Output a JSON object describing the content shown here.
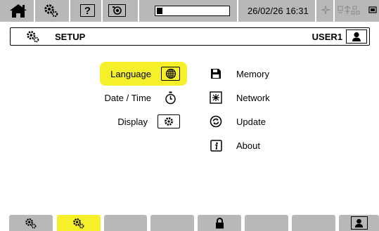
{
  "status_bar": {
    "datetime": "26/02/26 16:31",
    "battery_level": 0.08,
    "icons": [
      "home-icon",
      "gear-icon",
      "help-icon",
      "camera-icon",
      "battery-icon",
      "gps-icon",
      "usb-network-icon",
      "storage-icon"
    ],
    "help_glyph": "?"
  },
  "header": {
    "title": "SETUP",
    "user": "USER1"
  },
  "menu": {
    "left": [
      {
        "label": "Language",
        "icon": "globe-icon",
        "selected": true
      },
      {
        "label": "Date / Time",
        "icon": "stopwatch-icon",
        "selected": false
      },
      {
        "label": "Display",
        "icon": "display-gear-icon",
        "selected": false
      }
    ],
    "right": [
      {
        "label": "Memory",
        "icon": "floppy-icon"
      },
      {
        "label": "Network",
        "icon": "network-icon"
      },
      {
        "label": "Update",
        "icon": "update-icon"
      },
      {
        "label": "About",
        "icon": "info-icon"
      }
    ]
  },
  "tabs": [
    {
      "icon": "gear-icon",
      "active": false
    },
    {
      "icon": "gear-icon",
      "active": true
    },
    {
      "icon": "",
      "active": false
    },
    {
      "icon": "",
      "active": false
    },
    {
      "icon": "lock-icon",
      "active": false
    },
    {
      "icon": "",
      "active": false
    },
    {
      "icon": "",
      "active": false
    },
    {
      "icon": "user-icon",
      "active": false
    }
  ],
  "colors": {
    "highlight": "#f5f02a",
    "bar_gray": "#b8b8b8",
    "icon_gray": "#8a8a8a"
  }
}
